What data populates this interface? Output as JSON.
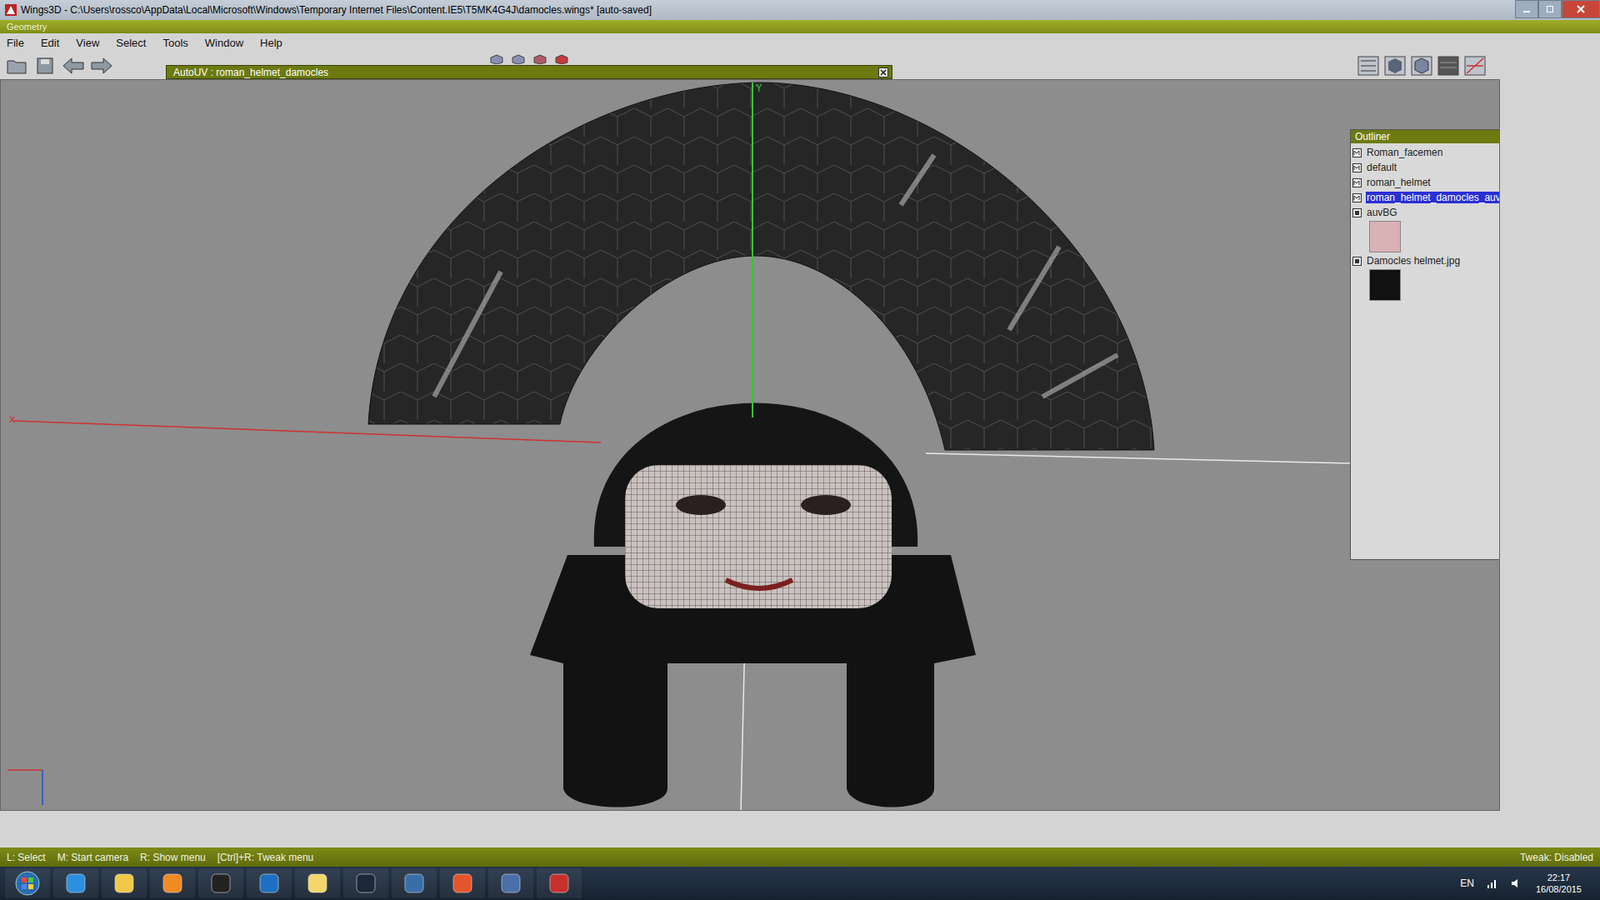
{
  "window": {
    "title": "Wings3D - C:\\Users\\rossco\\AppData\\Local\\Microsoft\\Windows\\Temporary Internet Files\\Content.IE5\\T5MK4G4J\\damocles.wings* [auto-saved]"
  },
  "panel_title": "Geometry",
  "menu": [
    "File",
    "Edit",
    "View",
    "Select",
    "Tools",
    "Window",
    "Help"
  ],
  "viewport": {
    "title": "AutoUV : roman_helmet_damocles",
    "axis_labels": {
      "x": "x",
      "y": "Y"
    }
  },
  "outliner": {
    "title": "Outliner",
    "items": [
      {
        "label": "Roman_facemen",
        "kind": "material",
        "selected": false
      },
      {
        "label": "default",
        "kind": "material",
        "selected": false
      },
      {
        "label": "roman_helmet",
        "kind": "material",
        "selected": false
      },
      {
        "label": "roman_helmet_damocles_auv",
        "kind": "material",
        "selected": true
      },
      {
        "label": "auvBG",
        "kind": "image",
        "selected": false,
        "color": "#d9b0b4"
      },
      {
        "label": "Damocles helmet.jpg",
        "kind": "image",
        "selected": false,
        "color": "#111111"
      }
    ]
  },
  "status_bar": {
    "hints": [
      "L: Select",
      "M: Start camera",
      "R: Show menu",
      "[Ctrl]+R: Tweak menu"
    ],
    "tweak": "Tweak: Disabled"
  },
  "taskbar": {
    "language": "EN",
    "time": "22:17",
    "date": "16/08/2015"
  }
}
